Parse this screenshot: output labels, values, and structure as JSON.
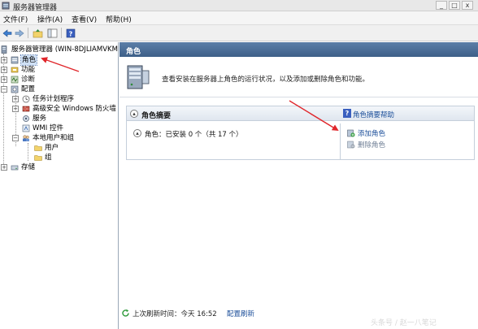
{
  "window": {
    "title": "服务器管理器",
    "buttons": [
      "_",
      "□",
      "x"
    ]
  },
  "menu": {
    "items": [
      "文件(F)",
      "操作(A)",
      "查看(V)",
      "帮助(H)"
    ]
  },
  "tree": {
    "root": "服务器管理器 (WIN-8DJLIAMVKM",
    "roles": "角色",
    "features": "功能",
    "diagnostics": "诊断",
    "configuration": "配置",
    "task_scheduler": "任务计划程序",
    "firewall": "高级安全 Windows 防火墙",
    "services": "服务",
    "wmi": "WMI 控件",
    "local_users": "本地用户和组",
    "users": "用户",
    "groups": "组",
    "storage": "存储"
  },
  "main": {
    "header": "角色",
    "description": "查看安装在服务器上角色的运行状况，以及添加或删除角色和功能。",
    "summary_title": "角色摘要",
    "summary_help": "角色摘要帮助",
    "roles_status": "角色：已安装 0 个（共 17 个）",
    "add_roles": "添加角色",
    "remove_roles": "删除角色"
  },
  "status": {
    "last_refresh": "上次刷新时间：今天 16:52",
    "refresh_link": "配置刷新"
  },
  "watermark": "头条号 / 赵一八笔记",
  "colors": {
    "header_bg": "#4a6d97",
    "link": "#1c4f9a",
    "annotation": "#e0262b"
  }
}
